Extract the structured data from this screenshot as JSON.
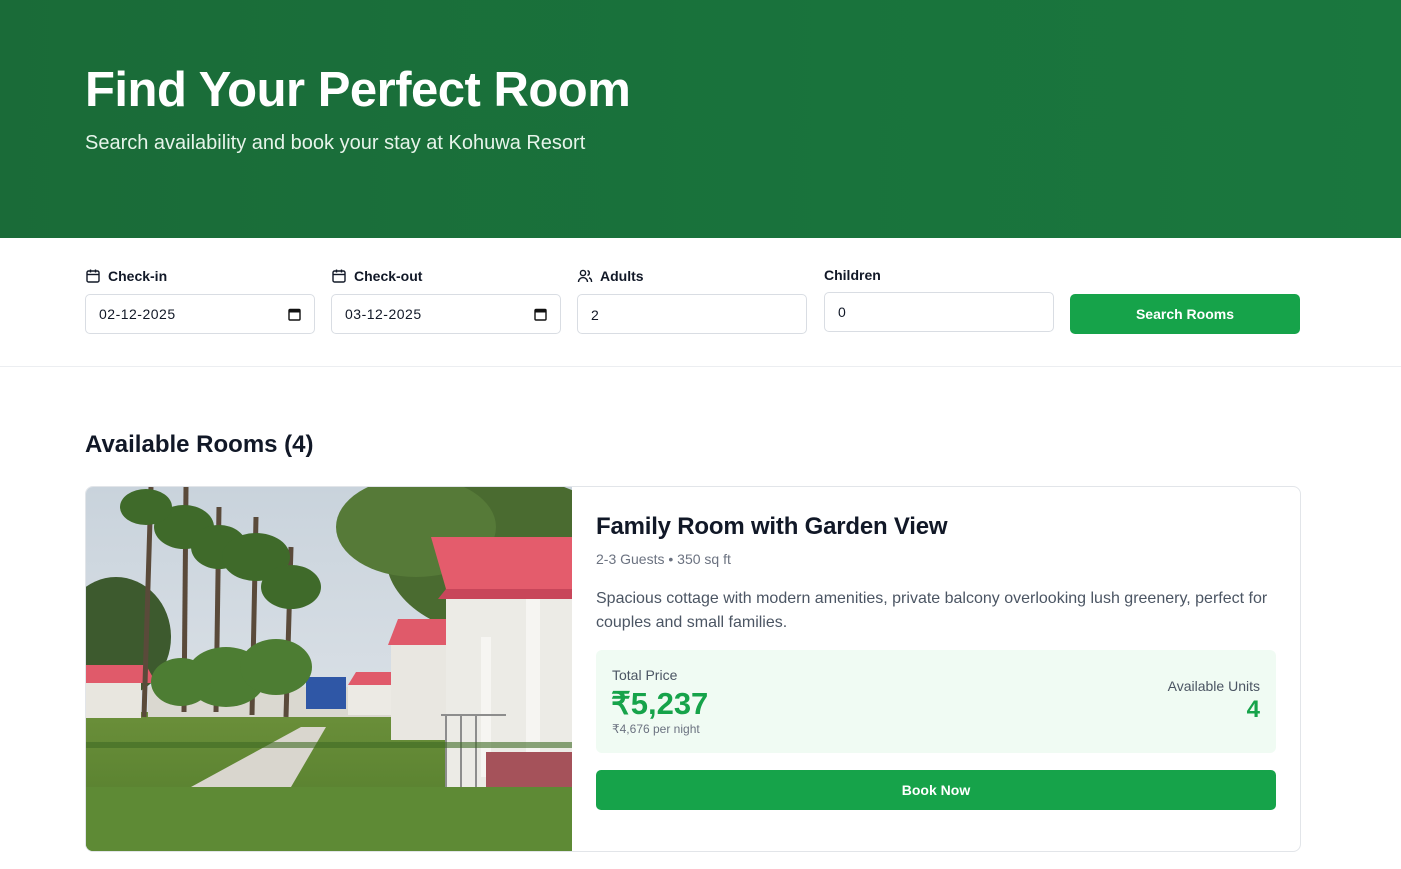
{
  "hero": {
    "title": "Find Your Perfect Room",
    "subtitle": "Search availability and book your stay at Kohuwa Resort",
    "background_color": "#19733c"
  },
  "search": {
    "checkin": {
      "label": "Check-in",
      "value": "02-12-2025",
      "icon": "calendar-icon"
    },
    "checkout": {
      "label": "Check-out",
      "value": "03-12-2025",
      "icon": "calendar-icon"
    },
    "adults": {
      "label": "Adults",
      "value": "2",
      "icon": "users-icon"
    },
    "children": {
      "label": "Children",
      "value": "0"
    },
    "button_label": "Search Rooms",
    "accent_color": "#16a34a"
  },
  "results": {
    "heading": "Available Rooms (4)",
    "rooms": [
      {
        "name": "Family Room with Garden View",
        "guests": "2-3 Guests",
        "size": "350 sq ft",
        "description": "Spacious cottage with modern amenities, private balcony overlooking lush greenery, perfect for couples and small families.",
        "total_price_label": "Total Price",
        "total_price": "₹5,237",
        "per_night": "₹4,676 per night",
        "units_label": "Available Units",
        "units": "4",
        "book_label": "Book Now"
      }
    ]
  }
}
